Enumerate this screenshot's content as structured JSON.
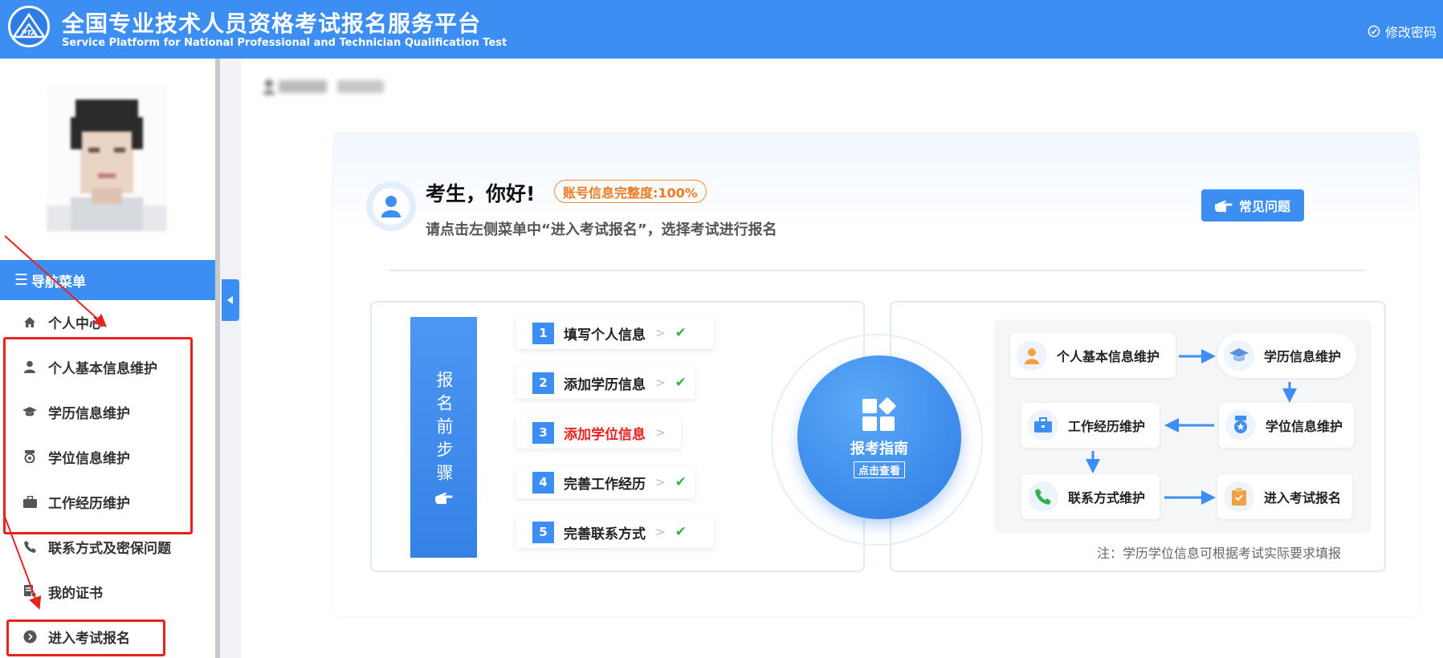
{
  "header": {
    "title": "全国专业技术人员资格考试报名服务平台",
    "subtitle": "Service Platform for National Professional and Technician Qualification Test",
    "logo_text": "PTA",
    "change_password": "修改密码"
  },
  "sidebar": {
    "nav_title": "导航菜单",
    "items": [
      {
        "label": "个人中心",
        "icon": "home-icon"
      },
      {
        "label": "个人基本信息维护",
        "icon": "user-icon"
      },
      {
        "label": "学历信息维护",
        "icon": "graduation-cap-icon"
      },
      {
        "label": "学位信息维护",
        "icon": "medal-icon"
      },
      {
        "label": "工作经历维护",
        "icon": "briefcase-icon"
      },
      {
        "label": "联系方式及密保问题",
        "icon": "phone-icon"
      },
      {
        "label": "我的证书",
        "icon": "certificate-icon"
      },
      {
        "label": "进入考试报名",
        "icon": "arrow-circle-icon"
      }
    ]
  },
  "welcome": {
    "greeting": "考生，你好!",
    "completeness": "账号信息完整度:100%",
    "instruction": "请点击左侧菜单中“进入考试报名”，选择考试进行报名",
    "faq_button": "常见问题"
  },
  "steps": {
    "banner": "报名前步骤",
    "items": [
      {
        "num": "1",
        "label": "填写个人信息",
        "done": true
      },
      {
        "num": "2",
        "label": "添加学历信息",
        "done": true
      },
      {
        "num": "3",
        "label": "添加学位信息",
        "done": false
      },
      {
        "num": "4",
        "label": "完善工作经历",
        "done": true
      },
      {
        "num": "5",
        "label": "完善联系方式",
        "done": true
      }
    ],
    "arrow": ">",
    "check": "✔"
  },
  "guide": {
    "title": "报考指南",
    "subtitle": "点击查看"
  },
  "flow": {
    "nodes": [
      {
        "label": "个人基本信息维护"
      },
      {
        "label": "学历信息维护"
      },
      {
        "label": "工作经历维护"
      },
      {
        "label": "学位信息维护"
      },
      {
        "label": "联系方式维护"
      },
      {
        "label": "进入考试报名"
      }
    ],
    "note": "注：学历学位信息可根据考试实际要求填报"
  },
  "colors": {
    "primary": "#3d8ef3",
    "annotation_red": "#e8231f",
    "check_green": "#2fb34a",
    "warning_orange": "#f07a20",
    "step3_red": "#e8231f"
  }
}
